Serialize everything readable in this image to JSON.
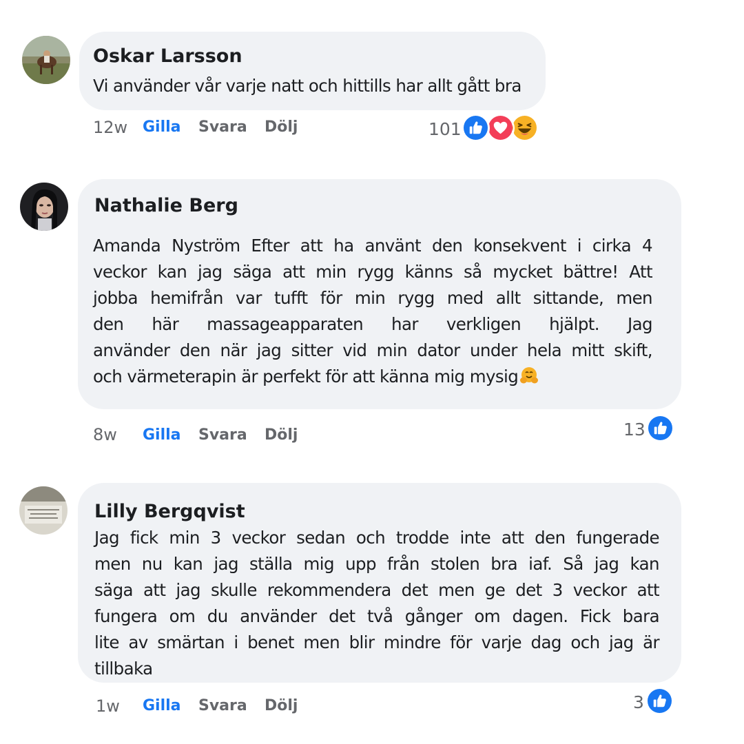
{
  "comments": [
    {
      "author": "Oskar Larsson",
      "lines": [
        "Vi använder vår varje natt och hittills har allt gått bra"
      ],
      "time": "12w",
      "actions": {
        "like": "Gilla",
        "reply": "Svara",
        "hide": "Dölj"
      },
      "reaction_count": "101",
      "reactions": [
        "like-icon",
        "love-icon",
        "haha-icon"
      ]
    },
    {
      "author": "Nathalie Berg",
      "lines": [
        "Amanda Nyström Efter att ha använt den konsekvent i cirka 4",
        "veckor kan jag säga att min rygg känns så mycket bättre! Att",
        "jobba hemifrån var tufft för min rygg med allt sittande, men",
        "den här massageapparaten har verkligen hjälpt. Jag",
        "använder den när jag sitter vid min dator under hela mitt skift,",
        "och värmeterapin är perfekt för att känna mig mysig"
      ],
      "trailing_emoji": "hugging-face-emoji",
      "time": "8w",
      "actions": {
        "like": "Gilla",
        "reply": "Svara",
        "hide": "Dölj"
      },
      "reaction_count": "13",
      "reactions": [
        "like-icon"
      ]
    },
    {
      "author": "Lilly Bergqvist",
      "lines": [
        "Jag fick min 3 veckor sedan och trodde inte att den fungerade",
        "men nu kan jag ställa mig upp från stolen bra iaf. Så jag kan",
        "säga att jag skulle rekommendera det men ge det 3 veckor att",
        "fungera om du använder det två gånger om dagen. Fick bara",
        "lite av smärtan i benet men blir mindre för varje dag och jag är",
        "tillbaka"
      ],
      "time": "1w",
      "actions": {
        "like": "Gilla",
        "reply": "Svara",
        "hide": "Dölj"
      },
      "reaction_count": "3",
      "reactions": [
        "like-icon"
      ]
    }
  ],
  "colors": {
    "bubble": "#f0f2f5",
    "like_blue": "#1877f2",
    "love_red": "#f33e58",
    "haha_yellow": "#f7b125",
    "muted": "#65676b"
  }
}
